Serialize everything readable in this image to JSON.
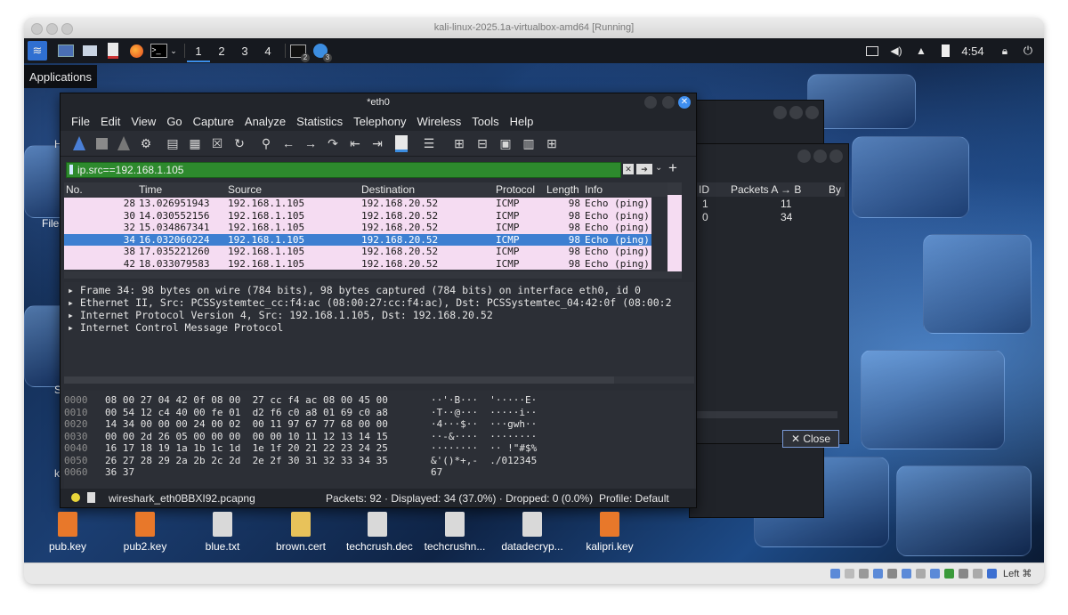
{
  "host": {
    "title": "kali-linux-2025.1a-virtualbox-amd64 [Running]",
    "host_key": "Left ⌘"
  },
  "panel": {
    "workspaces": [
      "1",
      "2",
      "3",
      "4"
    ],
    "active_workspace": 0,
    "badges": [
      "2",
      "3"
    ],
    "clock": "4:54"
  },
  "app_menu": {
    "label": "Applications"
  },
  "wireshark": {
    "title": "*eth0",
    "menu": [
      "File",
      "Edit",
      "View",
      "Go",
      "Capture",
      "Analyze",
      "Statistics",
      "Telephony",
      "Wireless",
      "Tools",
      "Help"
    ],
    "filter": {
      "value": "ip.src==192.168.1.105"
    },
    "columns": [
      "No.",
      "Time",
      "Source",
      "Destination",
      "Protocol",
      "Length",
      "Info"
    ],
    "packets": [
      {
        "no": "28",
        "time": "13.026951943",
        "src": "192.168.1.105",
        "dst": "192.168.20.52",
        "proto": "ICMP",
        "len": "98",
        "info": "Echo (ping)"
      },
      {
        "no": "30",
        "time": "14.030552156",
        "src": "192.168.1.105",
        "dst": "192.168.20.52",
        "proto": "ICMP",
        "len": "98",
        "info": "Echo (ping)"
      },
      {
        "no": "32",
        "time": "15.034867341",
        "src": "192.168.1.105",
        "dst": "192.168.20.52",
        "proto": "ICMP",
        "len": "98",
        "info": "Echo (ping)"
      },
      {
        "no": "34",
        "time": "16.032060224",
        "src": "192.168.1.105",
        "dst": "192.168.20.52",
        "proto": "ICMP",
        "len": "98",
        "info": "Echo (ping)"
      },
      {
        "no": "38",
        "time": "17.035221260",
        "src": "192.168.1.105",
        "dst": "192.168.20.52",
        "proto": "ICMP",
        "len": "98",
        "info": "Echo (ping)"
      },
      {
        "no": "42",
        "time": "18.033079583",
        "src": "192.168.1.105",
        "dst": "192.168.20.52",
        "proto": "ICMP",
        "len": "98",
        "info": "Echo (ping)"
      }
    ],
    "selected_row": 3,
    "details": [
      "Frame 34: 98 bytes on wire (784 bits), 98 bytes captured (784 bits) on interface eth0, id 0",
      "Ethernet II, Src: PCSSystemtec_cc:f4:ac (08:00:27:cc:f4:ac), Dst: PCSSystemtec_04:42:0f (08:00:2",
      "Internet Protocol Version 4, Src: 192.168.1.105, Dst: 192.168.20.52",
      "Internet Control Message Protocol"
    ],
    "hex": [
      {
        "off": "0000",
        "bytes": "08 00 27 04 42 0f 08 00  27 cc f4 ac 08 00 45 00",
        "ascii": "··'·B···  '·····E·"
      },
      {
        "off": "0010",
        "bytes": "00 54 12 c4 40 00 fe 01  d2 f6 c0 a8 01 69 c0 a8",
        "ascii": "·T··@···  ·····i··"
      },
      {
        "off": "0020",
        "bytes": "14 34 00 00 00 24 00 02  00 11 97 67 77 68 00 00",
        "ascii": "·4···$··  ···gwh··"
      },
      {
        "off": "0030",
        "bytes": "00 00 2d 26 05 00 00 00  00 00 10 11 12 13 14 15",
        "ascii": "··-&····  ········"
      },
      {
        "off": "0040",
        "bytes": "16 17 18 19 1a 1b 1c 1d  1e 1f 20 21 22 23 24 25",
        "ascii": "········  ·· !\"#$%"
      },
      {
        "off": "0050",
        "bytes": "26 27 28 29 2a 2b 2c 2d  2e 2f 30 31 32 33 34 35",
        "ascii": "&'()*+,-  ./012345"
      },
      {
        "off": "0060",
        "bytes": "36 37",
        "ascii": "67"
      }
    ],
    "status": {
      "file": "wireshark_eth0BBXI92.pcapng",
      "packets": "Packets: 92 · Displayed: 34 (37.0%) · Dropped: 0 (0.0%)",
      "profile": "Profile: Default"
    }
  },
  "conversations": {
    "columns": [
      "ID",
      "Packets A → B",
      "By"
    ],
    "rows": [
      {
        "id": "1",
        "packets": "11"
      },
      {
        "id": "0",
        "packets": "34"
      }
    ],
    "close_label": "✕ Close"
  },
  "desktop": {
    "left_labels": [
      "H",
      "File",
      "S",
      "k"
    ],
    "icons": [
      {
        "label": "pub.key",
        "color": "#e8782a"
      },
      {
        "label": "pub2.key",
        "color": "#e8782a"
      },
      {
        "label": "blue.txt",
        "color": "#d9d9d9"
      },
      {
        "label": "brown.cert",
        "color": "#e8c25a"
      },
      {
        "label": "techcrush.dec",
        "color": "#d9d9d9"
      },
      {
        "label": "techcrushn...",
        "color": "#d9d9d9"
      },
      {
        "label": "datadecryp...",
        "color": "#d9d9d9"
      },
      {
        "label": "kalipri.key",
        "color": "#e8782a"
      }
    ]
  }
}
